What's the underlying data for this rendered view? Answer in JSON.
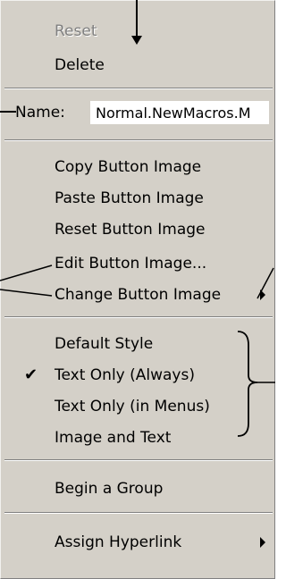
{
  "menu": {
    "reset": "Reset",
    "delete": "Delete",
    "name_label": "Name:",
    "name_value": "Normal.NewMacros.M",
    "copy_button_image": "Copy Button Image",
    "paste_button_image": "Paste Button Image",
    "reset_button_image": "Reset Button Image",
    "edit_button_image": "Edit Button Image...",
    "change_button_image": "Change Button Image",
    "default_style": "Default Style",
    "text_only_always": "Text Only (Always)",
    "text_only_menus": "Text Only (in Menus)",
    "image_and_text": "Image and Text",
    "begin_group": "Begin a Group",
    "assign_hyperlink": "Assign Hyperlink"
  },
  "state": {
    "reset_enabled": false,
    "checked_item": "Text Only (Always)"
  },
  "icons": {
    "submenu": "submenu-arrow-icon",
    "check": "checkmark-icon"
  },
  "colors": {
    "menu_background": "#d4d0c8",
    "disabled_text": "#808080",
    "input_background": "#ffffff"
  }
}
